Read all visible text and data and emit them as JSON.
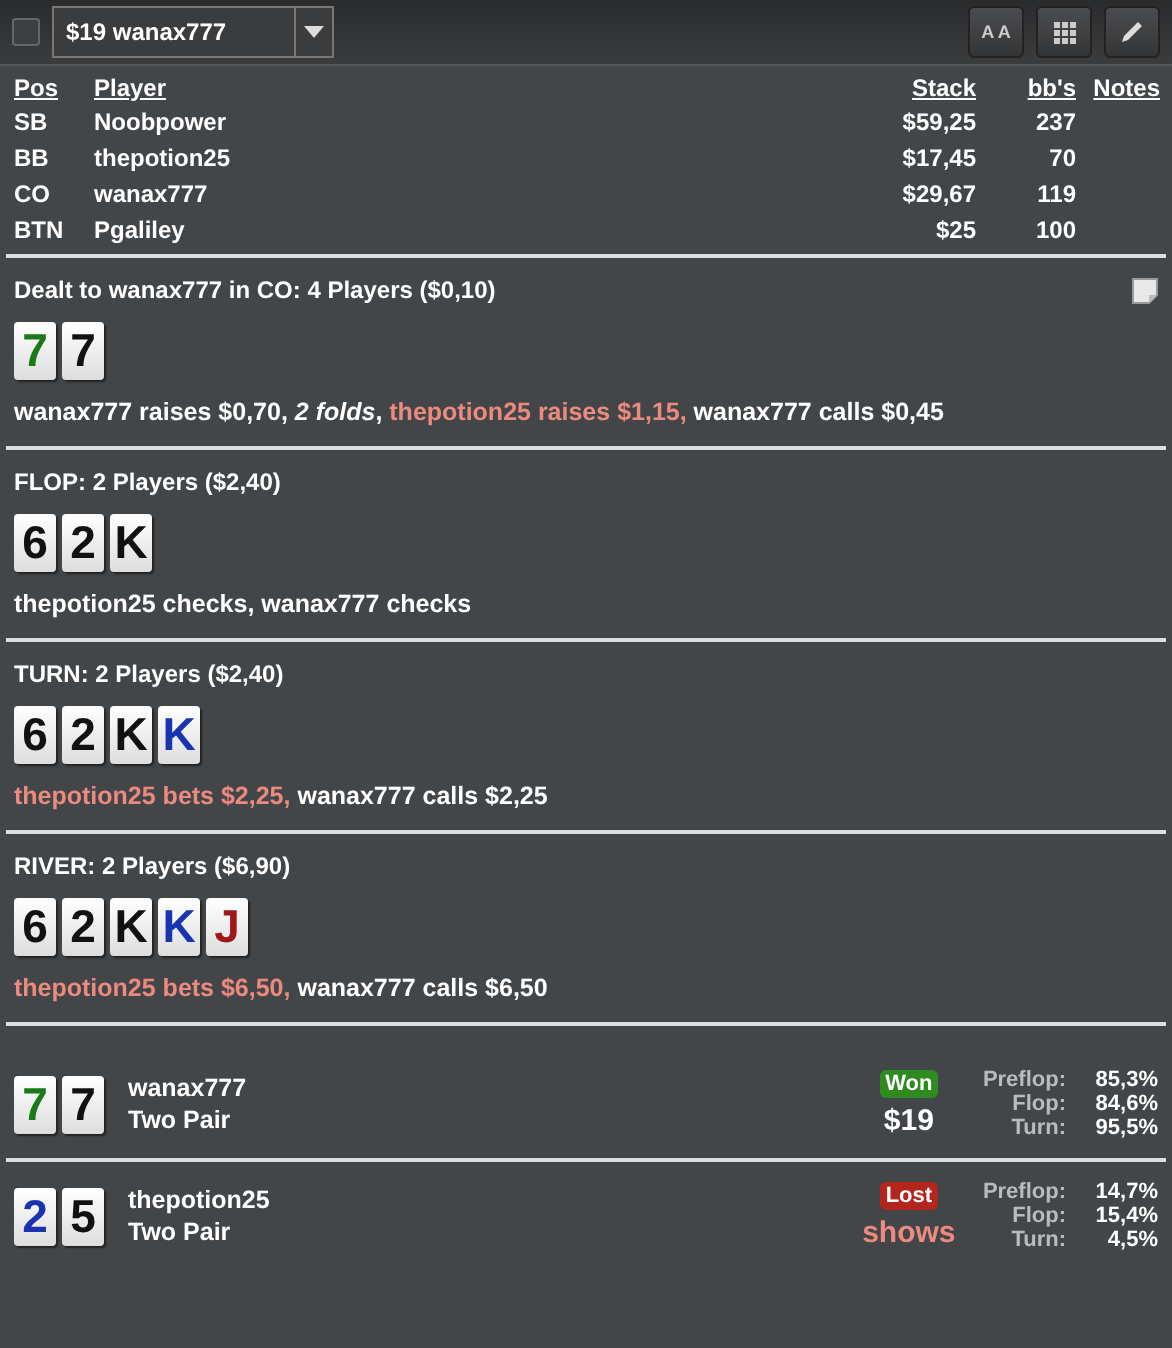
{
  "toolbar": {
    "checked": false,
    "hand_select": "$19 wanax777",
    "buttons": [
      "A A"
    ]
  },
  "players": {
    "columns": [
      "Pos",
      "Player",
      "Stack",
      "bb's",
      "Notes"
    ],
    "rows": [
      {
        "pos": "SB",
        "player": "Noobpower",
        "stack": "$59,25",
        "bbs": "237"
      },
      {
        "pos": "BB",
        "player": "thepotion25",
        "stack": "$17,45",
        "bbs": "70"
      },
      {
        "pos": "CO",
        "player": "wanax777",
        "stack": "$29,67",
        "bbs": "119"
      },
      {
        "pos": "BTN",
        "player": "Pgaliley",
        "stack": "$25",
        "bbs": "100"
      }
    ]
  },
  "streets": [
    {
      "title": "Dealt to wanax777 in CO: 4 Players ($0,10)",
      "note": true,
      "cards": [
        {
          "rank": "7",
          "color": "#1a7a1a"
        },
        {
          "rank": "7",
          "color": "#111111"
        }
      ],
      "actions": [
        {
          "text": "wanax777 raises $0,70, ",
          "kind": "hero"
        },
        {
          "text": "2 folds",
          "kind": "fold"
        },
        {
          "text": ", ",
          "kind": "hero"
        },
        {
          "text": "thepotion25 raises $1,15, ",
          "kind": "villain"
        },
        {
          "text": "wanax777 calls $0,45",
          "kind": "hero"
        }
      ]
    },
    {
      "title": "FLOP: 2 Players ($2,40)",
      "note": false,
      "cards": [
        {
          "rank": "6",
          "color": "#111111"
        },
        {
          "rank": "2",
          "color": "#111111"
        },
        {
          "rank": "K",
          "color": "#111111"
        }
      ],
      "actions": [
        {
          "text": "thepotion25 checks, wanax777 checks",
          "kind": "hero"
        }
      ]
    },
    {
      "title": "TURN: 2 Players ($2,40)",
      "note": false,
      "cards": [
        {
          "rank": "6",
          "color": "#111111"
        },
        {
          "rank": "2",
          "color": "#111111"
        },
        {
          "rank": "K",
          "color": "#111111"
        },
        {
          "rank": "K",
          "color": "#1a33b0"
        }
      ],
      "actions": [
        {
          "text": "thepotion25 bets $2,25, ",
          "kind": "villain"
        },
        {
          "text": "wanax777 calls $2,25",
          "kind": "hero"
        }
      ]
    },
    {
      "title": "RIVER: 2 Players ($6,90)",
      "note": false,
      "cards": [
        {
          "rank": "6",
          "color": "#111111"
        },
        {
          "rank": "2",
          "color": "#111111"
        },
        {
          "rank": "K",
          "color": "#111111"
        },
        {
          "rank": "K",
          "color": "#1a33b0"
        },
        {
          "rank": "J",
          "color": "#a01818"
        }
      ],
      "actions": [
        {
          "text": "thepotion25 bets $6,50, ",
          "kind": "villain"
        },
        {
          "text": "wanax777 calls $6,50",
          "kind": "hero"
        }
      ]
    }
  ],
  "results": [
    {
      "cards": [
        {
          "rank": "7",
          "color": "#1a7a1a"
        },
        {
          "rank": "7",
          "color": "#111111"
        }
      ],
      "player": "wanax777",
      "hand": "Two Pair",
      "outcome": {
        "label": "Won",
        "kind": "won"
      },
      "amount": "$19",
      "equity": [
        {
          "label": "Preflop:",
          "value": "85,3%"
        },
        {
          "label": "Flop:",
          "value": "84,6%"
        },
        {
          "label": "Turn:",
          "value": "95,5%"
        }
      ]
    },
    {
      "cards": [
        {
          "rank": "2",
          "color": "#1a33b0"
        },
        {
          "rank": "5",
          "color": "#111111"
        }
      ],
      "player": "thepotion25",
      "hand": "Two Pair",
      "outcome": {
        "label": "Lost",
        "kind": "lost"
      },
      "amount": "shows",
      "equity": [
        {
          "label": "Preflop:",
          "value": "14,7%"
        },
        {
          "label": "Flop:",
          "value": "15,4%"
        },
        {
          "label": "Turn:",
          "value": "4,5%"
        }
      ]
    }
  ]
}
